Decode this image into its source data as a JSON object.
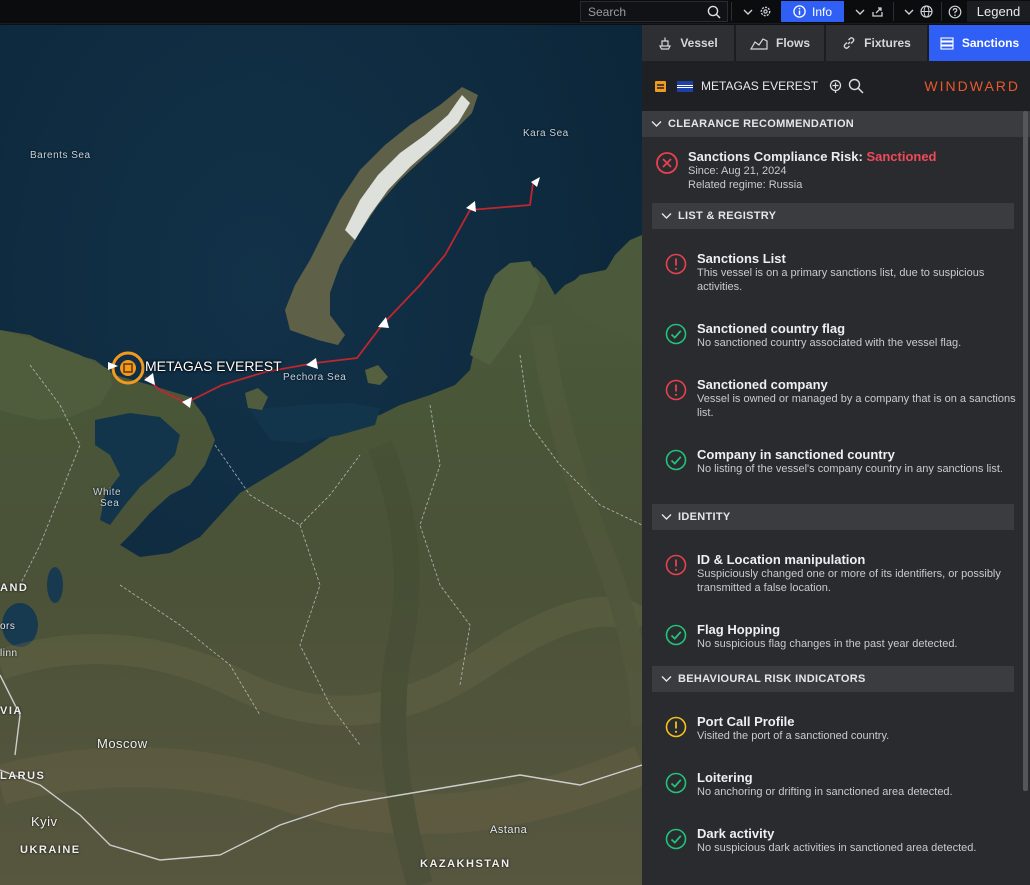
{
  "topbar": {
    "search_placeholder": "Search",
    "info_label": "Info",
    "legend_label": "Legend"
  },
  "map": {
    "vessel_label": "METAGAS EVEREST",
    "labels": {
      "barents": "Barents Sea",
      "kara": "Kara Sea",
      "pechora": "Pechora Sea",
      "white1": "White",
      "white2": "Sea",
      "moscow": "Moscow",
      "kyiv": "Kyiv",
      "astana": "Astana",
      "ukraine": "UKRAINE",
      "kazakhstan": "KAZAKHSTAN",
      "larus": "LARUS",
      "and": "AND",
      "via": "VIA",
      "ors": "ors",
      "linn": "linn"
    },
    "colors": {
      "track": "#c0262e",
      "vessel": "#f29a1f"
    }
  },
  "panel": {
    "tabs": [
      {
        "label": "Vessel",
        "icon": "ship-icon"
      },
      {
        "label": "Flows",
        "icon": "chart-icon"
      },
      {
        "label": "Fixtures",
        "icon": "link-icon"
      },
      {
        "label": "Sanctions",
        "icon": "list-icon",
        "active": true
      }
    ],
    "vessel_name": "METAGAS EVEREST",
    "brand": "WINDWARD",
    "clearance": {
      "header": "CLEARANCE RECOMMENDATION",
      "title": "Sanctions Compliance Risk: ",
      "status": "Sanctioned",
      "since": "Since: Aug 21, 2024",
      "regime": "Related regime: Russia"
    },
    "list_registry": {
      "header": "LIST & REGISTRY",
      "items": [
        {
          "title": "Sanctions List",
          "desc": "This vessel is on a primary sanctions list, due to suspicious activities.",
          "status": "alert"
        },
        {
          "title": "Sanctioned country flag",
          "desc": "No sanctioned country associated with the vessel flag.",
          "status": "ok"
        },
        {
          "title": "Sanctioned company",
          "desc": "Vessel is owned or managed by a company that is on a sanctions list.",
          "status": "alert"
        },
        {
          "title": "Company in sanctioned country",
          "desc": "No listing of the vessel's company country in any sanctions list.",
          "status": "ok"
        }
      ]
    },
    "identity": {
      "header": "IDENTITY",
      "items": [
        {
          "title": "ID & Location manipulation",
          "desc": "Suspiciously changed one or more of its identifiers, or possibly transmitted a false location.",
          "status": "alert"
        },
        {
          "title": "Flag Hopping",
          "desc": "No suspicious flag changes in the past year detected.",
          "status": "ok"
        }
      ]
    },
    "behavioural": {
      "header": "BEHAVIOURAL RISK INDICATORS",
      "items": [
        {
          "title": "Port Call Profile",
          "desc": "Visited the port of a sanctioned country.",
          "status": "warning"
        },
        {
          "title": "Loitering",
          "desc": "No anchoring or drifting in sanctioned area detected.",
          "status": "ok"
        },
        {
          "title": "Dark activity",
          "desc": "No suspicious dark activities in sanctioned area detected.",
          "status": "ok"
        }
      ]
    },
    "colors": {
      "alert": "#e8414f",
      "ok": "#22c47a",
      "warning": "#f3c21b",
      "accent": "#2f5ff5"
    }
  }
}
